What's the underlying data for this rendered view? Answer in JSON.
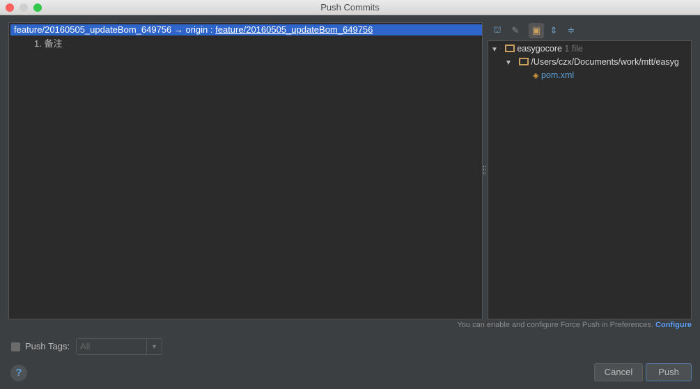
{
  "window": {
    "title": "Push Commits"
  },
  "commits": {
    "branch_local": "feature/20160505_updateBom_649756",
    "arrow": " → origin : ",
    "branch_remote": "feature/20160505_updateBom_649756",
    "items": [
      "1. 备注"
    ]
  },
  "toolbar": {
    "icons": [
      "commit-icon",
      "edit-source-icon",
      "group-by-directory-icon",
      "expand-all-icon",
      "collapse-all-icon"
    ]
  },
  "tree": {
    "module": "easygocore",
    "module_count": "1 file",
    "folder": "/Users/czx/Documents/work/mtt/easyg",
    "file": "pom.xml"
  },
  "hint": {
    "text": "You can enable and configure Force Push in Preferences. ",
    "link": "Configure"
  },
  "push_tags": {
    "label": "Push Tags:",
    "checked": false,
    "value": "All"
  },
  "buttons": {
    "cancel": "Cancel",
    "push": "Push",
    "help": "?"
  },
  "colors": {
    "selection": "#2f65ca",
    "link": "#589df6",
    "file": "#5a9fd6"
  }
}
